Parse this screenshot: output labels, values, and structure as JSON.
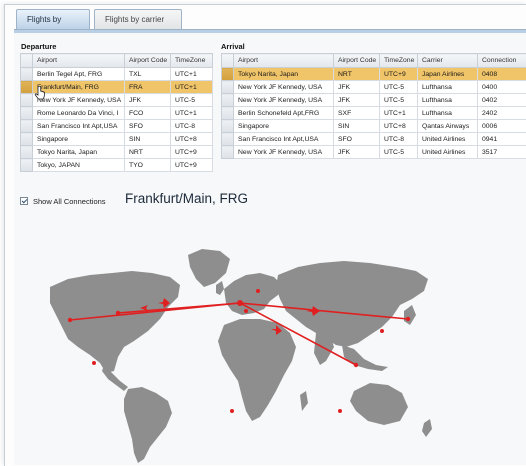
{
  "tabs": [
    {
      "label": "Flights by airports",
      "active": true
    },
    {
      "label": "Flights by carrier",
      "active": false
    }
  ],
  "departure": {
    "title": "Departure",
    "columns": [
      "Airport",
      "Airport Code",
      "TimeZone"
    ],
    "rows": [
      {
        "airport": "Berlin Tegel Apt, FRG",
        "code": "TXL",
        "tz": "UTC+1",
        "selected": false
      },
      {
        "airport": "Frankfurt/Main, FRG",
        "code": "FRA",
        "tz": "UTC+1",
        "selected": true
      },
      {
        "airport": "New York JF Kennedy, USA",
        "code": "JFK",
        "tz": "UTC-5",
        "selected": false
      },
      {
        "airport": "Rome Leonardo Da Vinci, I",
        "code": "FCO",
        "tz": "UTC+1",
        "selected": false
      },
      {
        "airport": "San Francisco Int Apt,USA",
        "code": "SFO",
        "tz": "UTC-8",
        "selected": false
      },
      {
        "airport": "Singapore",
        "code": "SIN",
        "tz": "UTC+8",
        "selected": false
      },
      {
        "airport": "Tokyo Narita, Japan",
        "code": "NRT",
        "tz": "UTC+9",
        "selected": false
      },
      {
        "airport": "Tokyo, JAPAN",
        "code": "TYO",
        "tz": "UTC+9",
        "selected": false
      }
    ]
  },
  "arrival": {
    "title": "Arrival",
    "columns": [
      "Airport",
      "Airport Code",
      "TimeZone",
      "Carrier",
      "Connection"
    ],
    "rows": [
      {
        "airport": "Tokyo Narita, Japan",
        "code": "NRT",
        "tz": "UTC+9",
        "carrier": "Japan Airlines",
        "connection": "0408",
        "selected": true
      },
      {
        "airport": "New York JF Kennedy, USA",
        "code": "JFK",
        "tz": "UTC-5",
        "carrier": "Lufthansa",
        "connection": "0400",
        "selected": false
      },
      {
        "airport": "New York JF Kennedy, USA",
        "code": "JFK",
        "tz": "UTC-5",
        "carrier": "Lufthansa",
        "connection": "0402",
        "selected": false
      },
      {
        "airport": "Berlin Schonefeld Apt,FRG",
        "code": "SXF",
        "tz": "UTC+1",
        "carrier": "Lufthansa",
        "connection": "2402",
        "selected": false
      },
      {
        "airport": "Singapore",
        "code": "SIN",
        "tz": "UTC+8",
        "carrier": "Qantas Airways",
        "connection": "0006",
        "selected": false
      },
      {
        "airport": "San Francisco Int Apt,USA",
        "code": "SFO",
        "tz": "UTC-8",
        "carrier": "United Airlines",
        "connection": "0941",
        "selected": false
      },
      {
        "airport": "New York JF Kennedy, USA",
        "code": "JFK",
        "tz": "UTC-5",
        "carrier": "United Airlines",
        "connection": "3517",
        "selected": false
      }
    ]
  },
  "options": {
    "show_all_label": "Show All Connections",
    "show_all_checked": true
  },
  "selected_airport": "Frankfurt/Main, FRG",
  "map": {
    "route_color": "#e02020",
    "land_color": "#8e8e8e",
    "routes": [
      {
        "from": "Frankfurt",
        "to": "San Francisco"
      },
      {
        "from": "Frankfurt",
        "to": "New York"
      },
      {
        "from": "Frankfurt",
        "to": "Tokyo"
      },
      {
        "from": "Frankfurt",
        "to": "Singapore"
      }
    ]
  }
}
